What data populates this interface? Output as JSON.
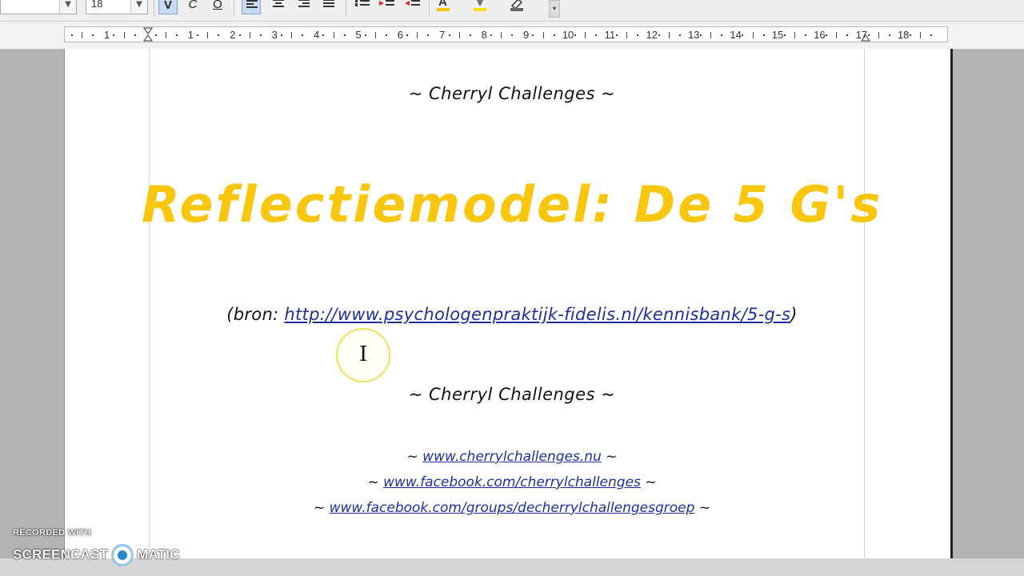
{
  "toolbar": {
    "font_size": "18",
    "buttons": {
      "italic": "V",
      "strike": "C",
      "underline": "O",
      "more": "▾"
    }
  },
  "ruler": {
    "labels": [
      "1",
      "1",
      "2",
      "3",
      "4",
      "5",
      "6",
      "7",
      "8",
      "9",
      "10",
      "11",
      "12",
      "13",
      "14",
      "15",
      "16",
      "17",
      "18"
    ]
  },
  "document": {
    "heading_top": "~ Cherryl Challenges ~",
    "title": "Reflectiemodel: De 5 G's",
    "source_prefix": "(bron: ",
    "source_link": "http://www.psychologenpraktijk-fidelis.nl/kennisbank/5-g-s",
    "source_suffix": ")",
    "heading_bottom": "~ Cherryl Challenges ~",
    "tilde": "~",
    "links": [
      "www.cherrylchallenges.nu",
      "www.facebook.com/cherrylchallenges",
      "www.facebook.com/groups/decherrylchallengesgroep"
    ]
  },
  "watermark": {
    "line1": "RECORDED WITH",
    "left": "SCREENCAST",
    "right": "MATIC"
  },
  "colors": {
    "title": "#f8c50f",
    "link": "#1e2fa0",
    "active_button": "#c7daf2"
  }
}
